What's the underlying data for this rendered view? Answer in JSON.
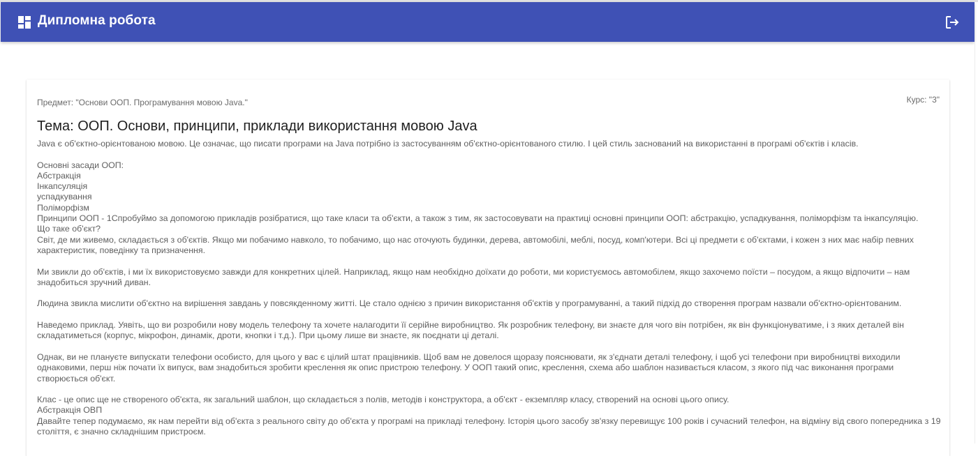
{
  "appbar": {
    "title": "Дипломна робота",
    "logo_icon": "dashboard-icon",
    "logout_icon": "logout-icon",
    "color": "#3f51b5"
  },
  "card": {
    "subject": "Предмет: \"Основи ООП. Програмування мовою Java.\"",
    "course": "Курс: \"3\"",
    "title": "Тема: ООП. Основи, принципи, приклади використання мовою Java",
    "intro": "Java є об'єктно-орієнтованою мовою. Це означає, що писати програми на Java потрібно із застосуванням об'єктно-орієнтованого стилю. І цей стиль заснований на використанні в програмі об'єктів і класів.",
    "principles_heading": "Основні засади ООП:",
    "principles": [
      "Абстракція",
      "Інкапсуляція",
      "успадкування",
      "Поліморфізм"
    ],
    "principles_intro": "Принципи ООП - 1Спробуймо за допомогою прикладів розібратися, що таке класи та об'єкти, а також з тим, як застосовувати на практиці основні принципи ООП: абстракцію, успадкування, поліморфізм та інкапсуляцію.",
    "what_is_object": "Що таке об'єкт?",
    "p_world": "Світ, де ми живемо, складається з об'єктів. Якщо ми побачимо навколо, то побачимо, що нас оточують будинки, дерева, автомобілі, меблі, посуд, комп'ютери. Всі ці предмети є об'єктами, і кожен з них має набір певних характеристик, поведінку та призначення.",
    "p_used": "Ми звикли до об'єктів, і ми їх використовуємо завжди для конкретних цілей. Наприклад, якщо нам необхідно доїхати до роботи, ми користуємось автомобілем, якщо захочемо поїсти – посудом, а якщо відпочити – нам знадобиться зручний диван.",
    "p_thinking": "Людина звикла мислити об'єктно на вирішення завдань у повсякденному житті. Це стало однією з причин використання об'єктів у програмуванні, а такий підхід до створення програм назвали об'єктно-орієнтованим.",
    "p_example": "Наведемо приклад. Уявіть, що ви розробили нову модель телефону та хочете налагодити її серійне виробництво. Як розробник телефону, ви знаєте для чого він потрібен, як він функціонуватиме, і з яких деталей він складатиметься (корпус, мікрофон, динамік, дроти, кнопки і т.д.). При цьому лише ви знаєте, як поєднати ці деталі.",
    "p_workers": "Однак, ви не плануєте випускати телефони особисто, для цього у вас є цілий штат працівників. Щоб вам не довелося щоразу пояснювати, як з'єднати деталі телефону, і щоб усі телефони при виробництві виходили однаковими, перш ніж почати їх випуск, вам знадобиться зробити креслення як опис пристрою телефону. У ООП такий опис, креслення, схема або шаблон називається класом, з якого під час виконання програми створюється об'єкт.",
    "p_class": "Клас - це опис ще не створеного об'єкта, як загальний шаблон, що складається з полів, методів і конструктора, а об'єкт - екземпляр класу, створений на основі цього опису.",
    "abstraction_heading": "Абстракція ОВП",
    "p_abstraction": "Давайте тепер подумаємо, як нам перейти від об'єкта з реального світу до об'єкта у програмі на прикладі телефону. Історія цього засобу зв'язку перевищує 100 років і сучасний телефон, на відміну від свого попередника з 19 століття, є значно складнішим пристроєм."
  }
}
